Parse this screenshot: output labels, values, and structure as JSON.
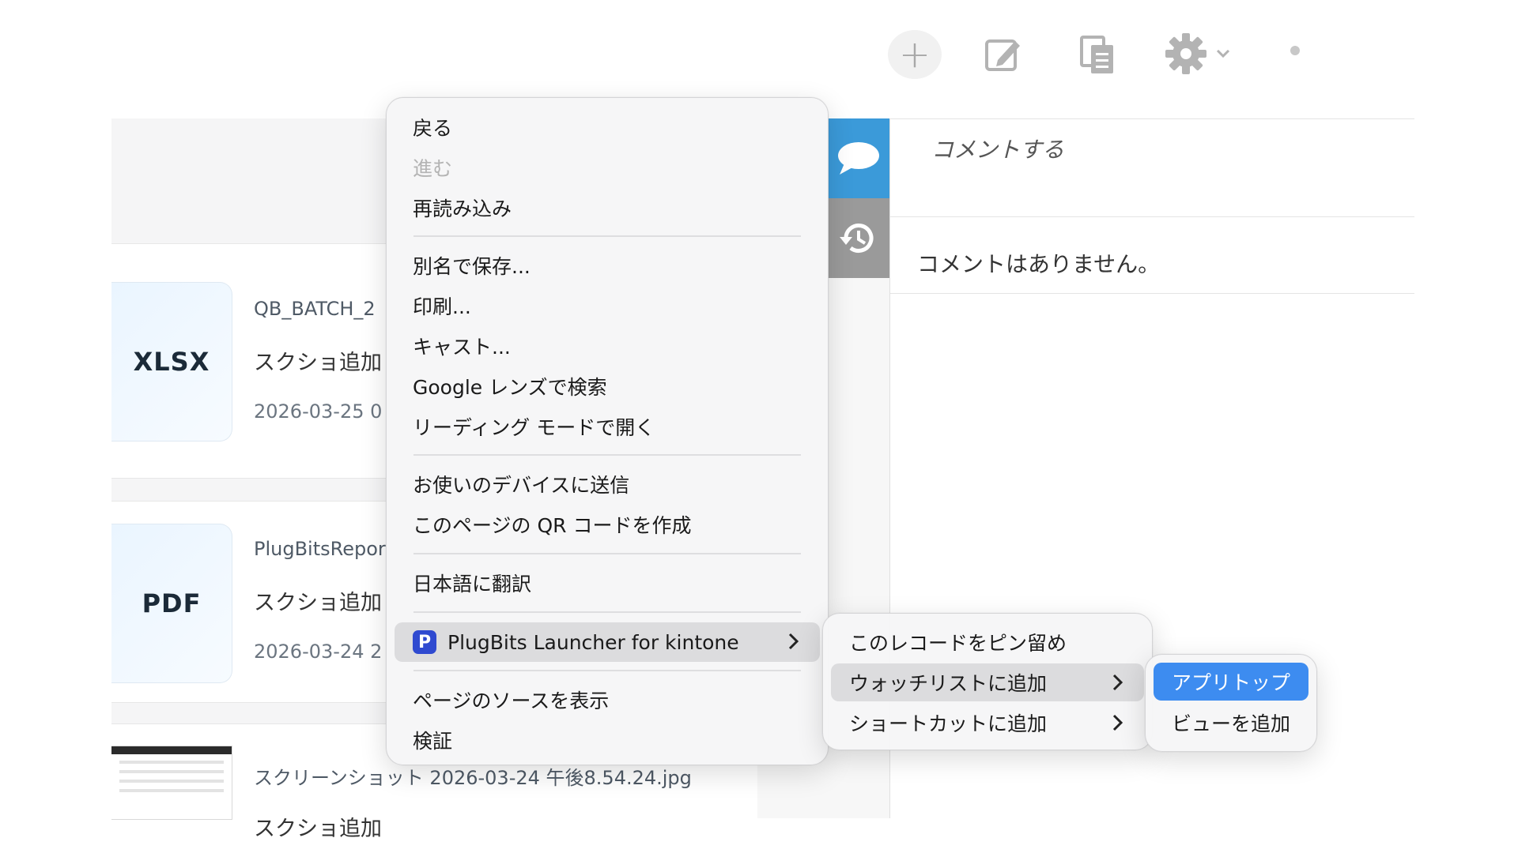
{
  "toolbar": {
    "icons": [
      "add-icon",
      "edit-icon",
      "copy-icon",
      "gear-icon",
      "chevron-down-icon",
      "more-dot-icon"
    ]
  },
  "files": [
    {
      "type": "XLSX",
      "name": "QB_BATCH_2",
      "note": "スクショ追加",
      "date": "2026-03-25 0"
    },
    {
      "type": "PDF",
      "name": "PlugBitsRepor",
      "note": "スクショ追加",
      "date": "2026-03-24 2"
    },
    {
      "type": "image",
      "name": "スクリーンショット 2026-03-24 午後8.54.24.jpg",
      "note": "スクショ追加"
    }
  ],
  "side_panel": {
    "comment_placeholder": "コメントする",
    "empty_text": "コメントはありません。",
    "colors": {
      "comment_tab": "#3b9ad9",
      "history_tab": "#9a9a9a"
    }
  },
  "context_menu": {
    "items": [
      {
        "label": "戻る"
      },
      {
        "label": "進む",
        "disabled": true
      },
      {
        "label": "再読み込み"
      },
      {
        "label": "別名で保存..."
      },
      {
        "label": "印刷..."
      },
      {
        "label": "キャスト..."
      },
      {
        "label": "Google レンズで検索"
      },
      {
        "label": "リーディング モードで開く"
      },
      {
        "label": "お使いのデバイスに送信"
      },
      {
        "label": "このページの QR コードを作成"
      },
      {
        "label": "日本語に翻訳"
      },
      {
        "label": "PlugBits Launcher for kintone",
        "icon": "P",
        "highlighted": true,
        "submenu": true
      },
      {
        "label": "ページのソースを表示"
      },
      {
        "label": "検証"
      }
    ]
  },
  "submenu": {
    "items": [
      {
        "label": "このレコードをピン留め"
      },
      {
        "label": "ウォッチリストに追加",
        "highlighted": true,
        "submenu": true
      },
      {
        "label": "ショートカットに追加",
        "submenu": true
      }
    ]
  },
  "submenu2": {
    "items": [
      {
        "label": "アプリトップ",
        "highlighted": true
      },
      {
        "label": "ビューを追加"
      }
    ]
  },
  "colors": {
    "highlight_blue": "#3d8cf0",
    "highlight_grey": "#dcdcde"
  }
}
